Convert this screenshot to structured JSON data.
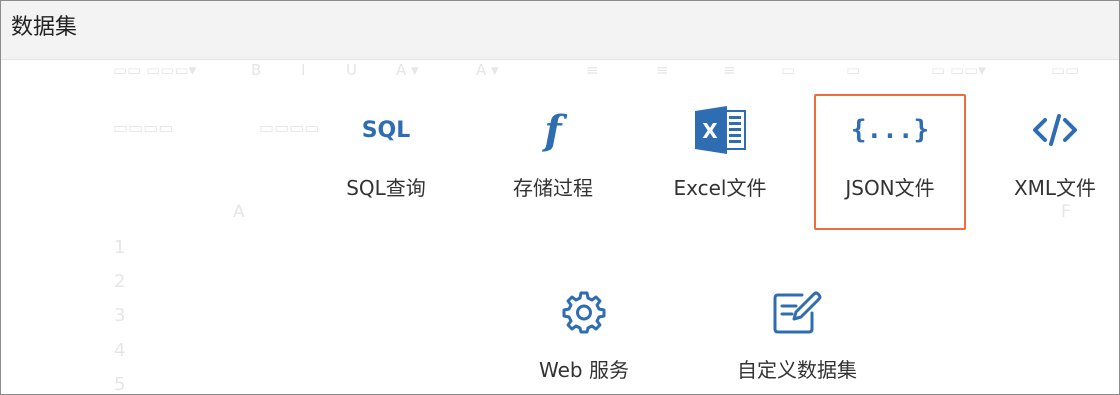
{
  "dialog": {
    "title": "数据集"
  },
  "accent": "#2f6db3",
  "selection_color": "#f26b3a",
  "options": [
    {
      "label": "SQL查询",
      "icon": "sql-icon",
      "icon_text": "SQL"
    },
    {
      "label": "存储过程",
      "icon": "function-icon",
      "icon_text": "f"
    },
    {
      "label": "Excel文件",
      "icon": "excel-icon",
      "icon_text": "X"
    },
    {
      "label": "JSON文件",
      "icon": "json-icon",
      "icon_text": "{...}",
      "selected": true
    },
    {
      "label": "XML文件",
      "icon": "xml-icon"
    },
    {
      "label": "Web 服务",
      "icon": "gear-icon"
    },
    {
      "label": "自定义数据集",
      "icon": "edit-icon"
    }
  ]
}
